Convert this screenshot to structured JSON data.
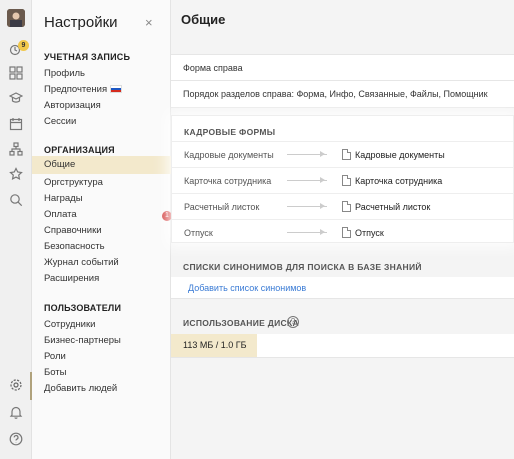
{
  "rail": {
    "badge_count": "9",
    "icons": [
      "avatar",
      "bell-badge-icon",
      "grid-icon",
      "education-icon",
      "calendar-icon",
      "org-icon",
      "star-icon",
      "search-icon",
      "gear-icon",
      "bell-icon",
      "help-icon"
    ]
  },
  "sidebar": {
    "title": "Настройки",
    "close": "×",
    "sections": {
      "account": "УЧЕТНАЯ ЗАПИСЬ",
      "org": "ОРГАНИЗАЦИЯ",
      "users": "ПОЛЬЗОВАТЕЛИ"
    },
    "account_items": [
      "Профиль",
      "Предпочтения",
      "Авторизация",
      "Сессии"
    ],
    "org_items": [
      "Общие",
      "Оргструктура",
      "Награды",
      "Оплата",
      "Справочники",
      "Безопасность",
      "Журнал событий",
      "Расширения"
    ],
    "payment_badge": "1",
    "user_items": [
      "Сотрудники",
      "Бизнес-партнеры",
      "Роли",
      "Боты",
      "Добавить людей"
    ]
  },
  "main": {
    "title": "Общие",
    "form_help": "Форма справа",
    "section_order": "Порядок разделов справа: Форма, Инфо, Связанные, Файлы, Помощник",
    "hr_forms": {
      "heading": "КАДРОВЫЕ ФОРМЫ",
      "rows": [
        {
          "label": "Кадровые документы",
          "value": "Кадровые документы"
        },
        {
          "label": "Карточка сотрудника",
          "value": "Карточка сотрудника"
        },
        {
          "label": "Расчетный листок",
          "value": "Расчетный листок"
        },
        {
          "label": "Отпуск",
          "value": "Отпуск"
        }
      ]
    },
    "synonyms": {
      "heading": "СПИСКИ СИНОНИМОВ ДЛЯ ПОИСКА В БАЗЕ ЗНАНИЙ",
      "link": "Добавить список синонимов"
    },
    "disk": {
      "heading": "ИСПОЛЬЗОВАНИЕ ДИСКА",
      "help": "?",
      "value": "113 МБ / 1.0 ГБ"
    }
  },
  "colors": {
    "active_highlight": "#f3e9cc",
    "link": "#3a7bd5",
    "badge_red": "#d23b3b",
    "badge_yellow": "#f1c84b"
  }
}
